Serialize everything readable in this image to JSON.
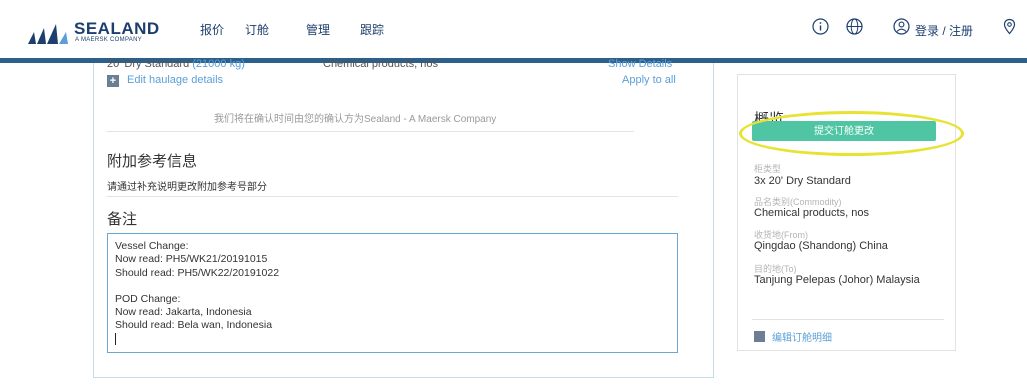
{
  "header": {
    "brand": "SEALAND",
    "brand_sub": "A MAERSK COMPANY",
    "nav": [
      "报价",
      "订舱",
      "管理",
      "跟踪"
    ],
    "login": "登录 / 注册",
    "icons": [
      "info-icon",
      "globe-icon",
      "user-icon",
      "location-pin-icon"
    ]
  },
  "main": {
    "cargo_row": {
      "type": "20' Dry Standard",
      "type_extra": "(21000 kg)",
      "commodity": "Chemical products, nos",
      "show_details": "Show Details"
    },
    "haulage": {
      "label": "Edit haulage details",
      "apply_all": "Apply to all"
    },
    "confirm_note": "我们将在确认时间由您的确认方为Sealand - A Maersk Company",
    "additional_ref": {
      "title": "附加参考信息",
      "desc": "请通过补充说明更改附加参考号部分"
    },
    "remarks": {
      "title": "备注",
      "lines": [
        "Vessel Change:",
        "Now read: PH5/WK21/20191015",
        "Should read: PH5/WK22/20191022",
        "",
        "POD Change:",
        "Now read: Jakarta, Indonesia",
        "Should read: Bela wan, Indonesia"
      ]
    }
  },
  "sidebar": {
    "title": "概览",
    "submit": "提交订舱更改",
    "fields": [
      {
        "label": "柜类型",
        "value": "3x 20' Dry Standard"
      },
      {
        "label": "品名类别(Commodity)",
        "value": "Chemical products, nos"
      },
      {
        "label": "收货地(From)",
        "value": "Qingdao (Shandong) China"
      },
      {
        "label": "目的地(To)",
        "value": "Tanjung Pelepas (Johor) Malaysia"
      }
    ],
    "edit_link": "编辑订舱明细"
  },
  "colors": {
    "accent_green": "#4fc5a3",
    "link_blue": "#5b9fd8",
    "brand_navy": "#1c3f6e",
    "highlight_yellow": "#e8e232"
  }
}
